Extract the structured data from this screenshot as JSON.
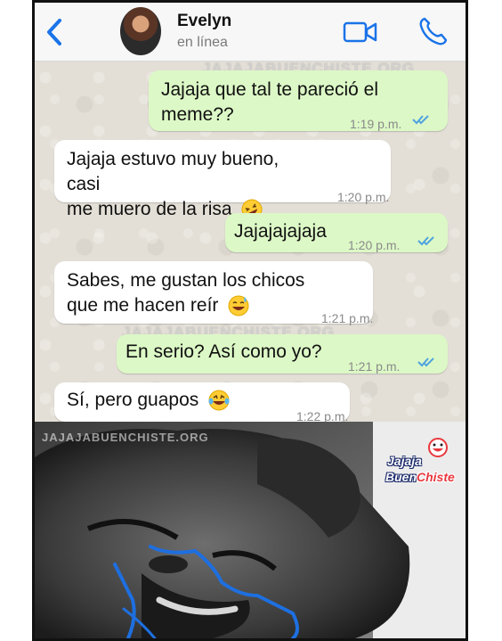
{
  "header": {
    "contact_name": "Evelyn",
    "status": "en línea",
    "accent": "#1a73e8"
  },
  "watermark": "JAJAJABUENCHISTE.ORG",
  "messages": [
    {
      "direction": "out",
      "text_line1": "Jajaja que tal te pareció el",
      "text_line2": "meme??",
      "time": "1:19 p.m.",
      "read": true
    },
    {
      "direction": "in",
      "text_line1": "Jajaja estuvo muy bueno, casi",
      "text_line2": "me muero de la risa",
      "emoji": "rofl-emoji",
      "time": "1:20 p.m."
    },
    {
      "direction": "out",
      "text_line1": "Jajajajajaja",
      "time": "1:20 p.m.",
      "read": true
    },
    {
      "direction": "in",
      "text_line1": "Sabes, me gustan los chicos",
      "text_line2": "que me hacen reír",
      "emoji": "sweat-smile-emoji",
      "time": "1:21 p.m."
    },
    {
      "direction": "out",
      "text_line1": "En serio? Así como yo?",
      "time": "1:21 p.m.",
      "read": true
    },
    {
      "direction": "in",
      "text_line1": "Sí, pero guapos",
      "emoji": "laughing-tears-emoji",
      "time": "1:22 p.m."
    }
  ],
  "meme": {
    "watermark": "JAJAJABUENCHISTE.ORG",
    "logo_line1": "Jajaja",
    "logo_line2_a": "Buen",
    "logo_line2_b": "Chiste"
  },
  "colors": {
    "outgoing_bubble": "#dcf8c6",
    "incoming_bubble": "#ffffff",
    "read_ticks": "#4fa3e0",
    "tear_lines": "#1e6fe0"
  }
}
